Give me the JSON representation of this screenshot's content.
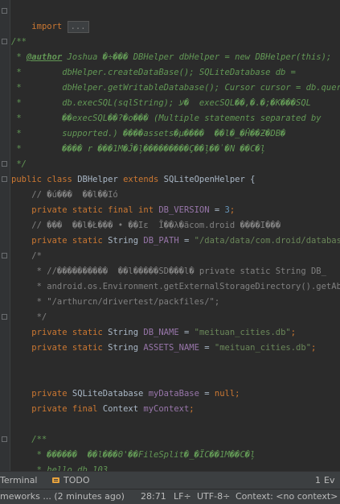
{
  "code_lines": [
    "import ...",
    "/**",
    " * @author Joshua �÷��� DBHelper dbHelper = new DBHelper(this);",
    " *        dbHelper.createDataBase(); SQLiteDatabase db =",
    " *        dbHelper.getWritableDatabase(); Cursor cursor = db.query(",
    " *        db.execSQL(sqlString); ע�  execSQL��,�.�;�K���SQL",
    " *        ��execSQL��?�ο��� (Multiple statements separated by",
    " *        supported.) ����assets�µ����  ��l�_�Ĥ��Ƶ�DB�",
    " *        ���� r ���1M�Ĵ�ļ���������Ç��ļ��̍�Ν ��C�ļ",
    " */",
    "public class DBHelper extends SQLiteOpenHelper {",
    "    // �ú���  ��l��Ιó",
    "    private static final int DB_VERSION = 3;",
    "    // ���  ��l�Ł��� • ��Iε  Ĩ��λ�ãcom.droid ����Ι���",
    "    private static String DB_PATH = \"/data/data/com.droid/databases/",
    "    /*",
    "     * //����������  ��l�����SD���l� private static String DB_",
    "     * android.os.Environment.getExternalStorageDirectory().getAbsolu",
    "     * \"/arthurcn/drivertest/packfiles/\";",
    "     */",
    "    private static String DB_NAME = \"meituan_cities.db\";",
    "    private static String ASSETS_NAME = \"meituan_cities.db\";",
    "    private SQLiteDatabase myDataBase = null;",
    "    private final Context myContext;",
    "    /**",
    "     * ������  ��l���Θ'��FileSplit�_�ÏC��1M��C�ļ",
    "     * hello.db.103"
  ],
  "toolbar": {
    "terminal_label": "Terminal",
    "todo_label": "TODO",
    "event_label": "Ev"
  },
  "status": {
    "message": "meworks ... (2 minutes ago)",
    "position": "28:71",
    "line_sep": "LF÷",
    "encoding": "UTF-8÷",
    "context": "Context: <no context>"
  }
}
